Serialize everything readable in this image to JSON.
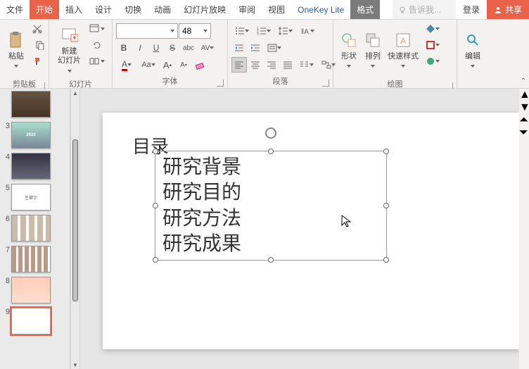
{
  "menu": {
    "file": "文件",
    "home": "开始",
    "insert": "插入",
    "design": "设计",
    "transition": "切换",
    "animation": "动画",
    "slideshow": "幻灯片放映",
    "review": "审阅",
    "view": "视图",
    "onekey": "OneKey Lite",
    "format": "格式",
    "tellme": "告诉我...",
    "login": "登录",
    "share": "共享"
  },
  "ribbon": {
    "clipboard": {
      "label": "剪贴板",
      "paste": "粘贴"
    },
    "slides": {
      "label": "幻灯片",
      "new": "新建\n幻灯片"
    },
    "font": {
      "label": "字体",
      "family": "",
      "size": "48"
    },
    "paragraph": {
      "label": "段落"
    },
    "drawing": {
      "label": "绘图",
      "shapes": "形状",
      "arrange": "排列",
      "quickstyle": "快速样式"
    },
    "editing": {
      "label": "编辑"
    }
  },
  "thumbs": [
    {
      "num": "",
      "preview": ""
    },
    {
      "num": "3",
      "preview": "2020"
    },
    {
      "num": "4",
      "preview": ""
    },
    {
      "num": "5",
      "preview": "生僻字"
    },
    {
      "num": "6",
      "preview": ""
    },
    {
      "num": "7",
      "preview": ""
    },
    {
      "num": "8",
      "preview": ""
    },
    {
      "num": "9",
      "preview": ""
    }
  ],
  "slide": {
    "title": "目录",
    "items": [
      "研究背景",
      "研究目的",
      "研究方法",
      "研究成果"
    ]
  }
}
